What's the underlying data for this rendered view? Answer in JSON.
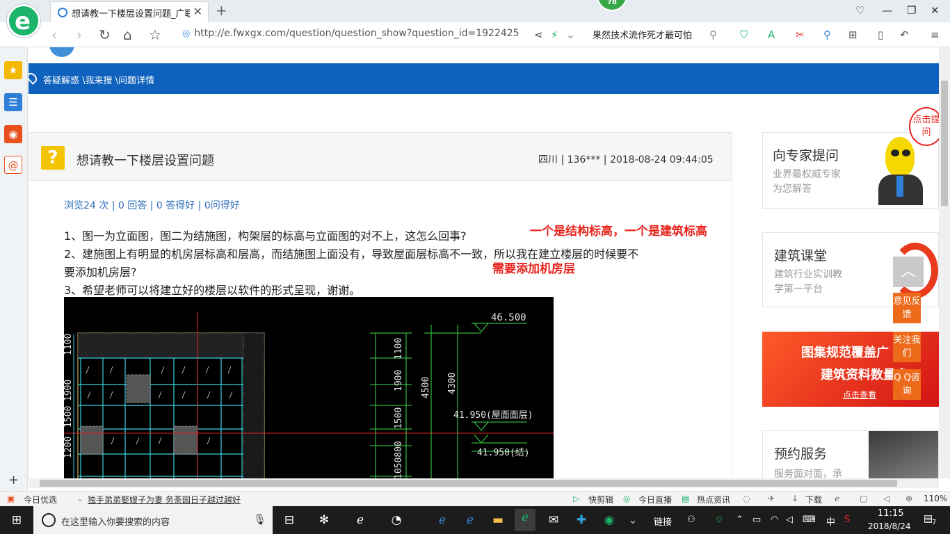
{
  "browser": {
    "tab_title": "想请教一下楼层设置问题_广联达",
    "new_tab_glyph": "+",
    "badge_number": "78",
    "url": "http://e.fwxgx.com/question/question_show?question_id=1922425",
    "search_text": "果然技术流作死才最可怕",
    "icons": [
      "back-icon",
      "forward-icon",
      "refresh-icon",
      "home-icon",
      "star-icon",
      "share-icon",
      "lightning-icon",
      "chevron-down-icon",
      "search-icon",
      "shield-icon",
      "translate-icon",
      "scissors-icon",
      "magnifier-icon",
      "grid-icon",
      "phone-icon",
      "undo-icon",
      "menu-icon"
    ]
  },
  "breadcrumb": "答疑解惑 \\我来搜 \\问题详情",
  "question": {
    "title": "想请教一下楼层设置问题",
    "meta": "四川 |  136*** | 2018-08-24 09:44:05",
    "stats": "浏览24 次 | 0 回答 | 0 答得好 | 0问得好",
    "para1": "1、图一为立面图，图二为结施图，构架层的标高与立面图的对不上，这怎么回事?",
    "para2a": "2、建施图上有明显的机房层标高和层高，而结施图上面没有，导致屋面层标高不一致，所以我在建立楼层的时候要不",
    "para2b": "要添加机房层?",
    "para3": "3、希望老师可以将建立好的楼层以软件的形式呈现，谢谢。",
    "annotation1": "一个是结构标高，一个是建筑标高",
    "annotation2": "需要添加机房层"
  },
  "cad": {
    "labels": {
      "top_elev": "46.500",
      "roof_elev": "41.950(屋面面层)",
      "struct_elev": "41.950(结)",
      "dims_left": [
        "1100",
        "1900",
        "1500",
        "1050800"
      ],
      "dim_4500": "4500",
      "dim_4300": "4300"
    },
    "colors": {
      "bg": "#000000",
      "cyan": "#39d3e0",
      "green": "#3ddc4a",
      "red": "#e02020",
      "white": "#e6e6e6",
      "yellow": "#e8e070"
    }
  },
  "right_cards": [
    {
      "title": "向专家提问",
      "sub1": "业界最权威专家",
      "sub2": "为您解答"
    },
    {
      "title": "建筑课堂",
      "sub1": "建筑行业实训教",
      "sub2": "学第一平台"
    },
    {
      "banner1": "图集规范覆盖广",
      "banner2": "建筑资料数量多",
      "cta": "点击查看"
    },
    {
      "title": "预约服务",
      "sub1": "服务面对面，承"
    }
  ],
  "bubble": "点击提问",
  "float_buttons": [
    "意见反馈",
    "关注我们",
    "Q Q咨询"
  ],
  "statusbar": {
    "left1": "今日优选",
    "left2": "独手弟弟娶嫂子为妻 务荼园日子越过越好",
    "r1": "快剪辑",
    "r2": "今日直播",
    "r3": "热点资讯",
    "r4": "下载",
    "zoom": "110%"
  },
  "taskbar": {
    "search_placeholder": "在这里输入你要搜索的内容",
    "tray_text": "链接",
    "ime": "中",
    "time": "11:15",
    "date": "2018/8/24",
    "notif": "7"
  },
  "accent": {
    "blue_bar": "#0e62bd",
    "orange": "#ec6a1a",
    "green_logo": "#1bb46a"
  }
}
